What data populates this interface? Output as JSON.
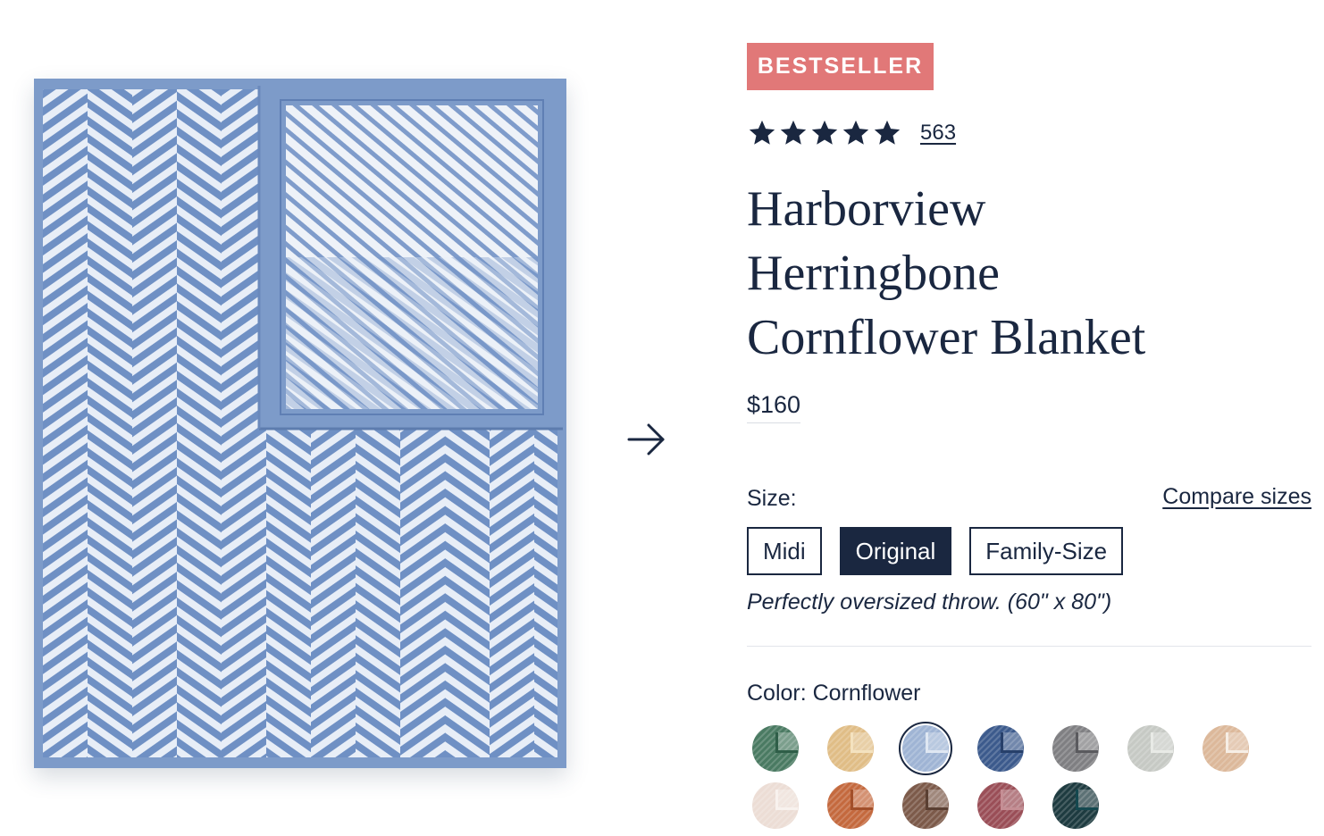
{
  "badge": "BESTSELLER",
  "rating": {
    "stars": 5,
    "review_count": "563"
  },
  "title_lines": [
    "Harborview",
    "Herringbone",
    "Cornflower Blanket"
  ],
  "price": "$160",
  "size": {
    "label": "Size:",
    "compare_link": "Compare sizes",
    "options": [
      "Midi",
      "Original",
      "Family-Size"
    ],
    "selected": "Original",
    "description": "Perfectly oversized throw. (60\" x 80\")"
  },
  "color": {
    "label": "Color: Cornflower",
    "selected_index": 2,
    "swatches": [
      {
        "name": "green",
        "hex": "#4a7a62",
        "edge": "#2f5e48"
      },
      {
        "name": "sand",
        "hex": "#e0bd86",
        "edge": "#f4e2bf"
      },
      {
        "name": "cornflower",
        "hex": "#9fb4d4",
        "edge": "#dfe7f2"
      },
      {
        "name": "navy-blue",
        "hex": "#3c5a8c",
        "edge": "#27406a"
      },
      {
        "name": "gray",
        "hex": "#7f7f82",
        "edge": "#5a5a5e"
      },
      {
        "name": "light-gray",
        "hex": "#c6c9c4",
        "edge": "#e8eae6"
      },
      {
        "name": "tan",
        "hex": "#dcb89a",
        "edge": "#f6eee5"
      },
      {
        "name": "blush",
        "hex": "#ecddd5",
        "edge": "#f8f2ee"
      },
      {
        "name": "rust",
        "hex": "#c4693e",
        "edge": "#a24f2a"
      },
      {
        "name": "brown",
        "hex": "#7c5a4a",
        "edge": "#5a3f32"
      },
      {
        "name": "burgundy",
        "hex": "#9a4e57",
        "edge": "#c58e94"
      },
      {
        "name": "dark-green",
        "hex": "#1e3b40",
        "edge": "#14484f"
      }
    ]
  },
  "icons": {
    "next": "arrow-right-icon",
    "star": "star-icon"
  },
  "colors": {
    "navy": "#1a2740",
    "badge": "#e17878",
    "blanket": "#7d9bc9"
  }
}
